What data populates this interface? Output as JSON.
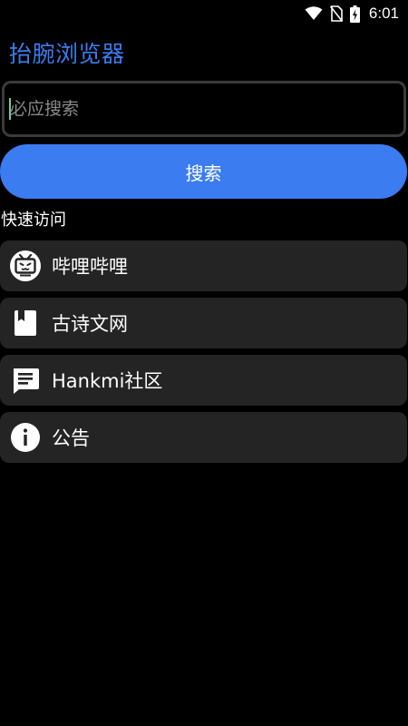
{
  "status_bar": {
    "time": "6:01",
    "icons": [
      "wifi-icon",
      "no-sim-icon",
      "battery-charging-icon"
    ]
  },
  "app": {
    "title": "抬腕浏览器"
  },
  "search": {
    "placeholder": "必应搜索",
    "value": "",
    "button_label": "搜索"
  },
  "quick_access": {
    "heading": "快速访问",
    "items": [
      {
        "label": "哔哩哔哩",
        "icon": "tv-icon"
      },
      {
        "label": "古诗文网",
        "icon": "bookmark-icon"
      },
      {
        "label": "Hankmi社区",
        "icon": "message-icon"
      },
      {
        "label": "公告",
        "icon": "info-icon"
      }
    ]
  },
  "colors": {
    "accent": "#3b7cf0",
    "background": "#000000",
    "card": "#242424",
    "input_border": "#3a3a3a"
  }
}
